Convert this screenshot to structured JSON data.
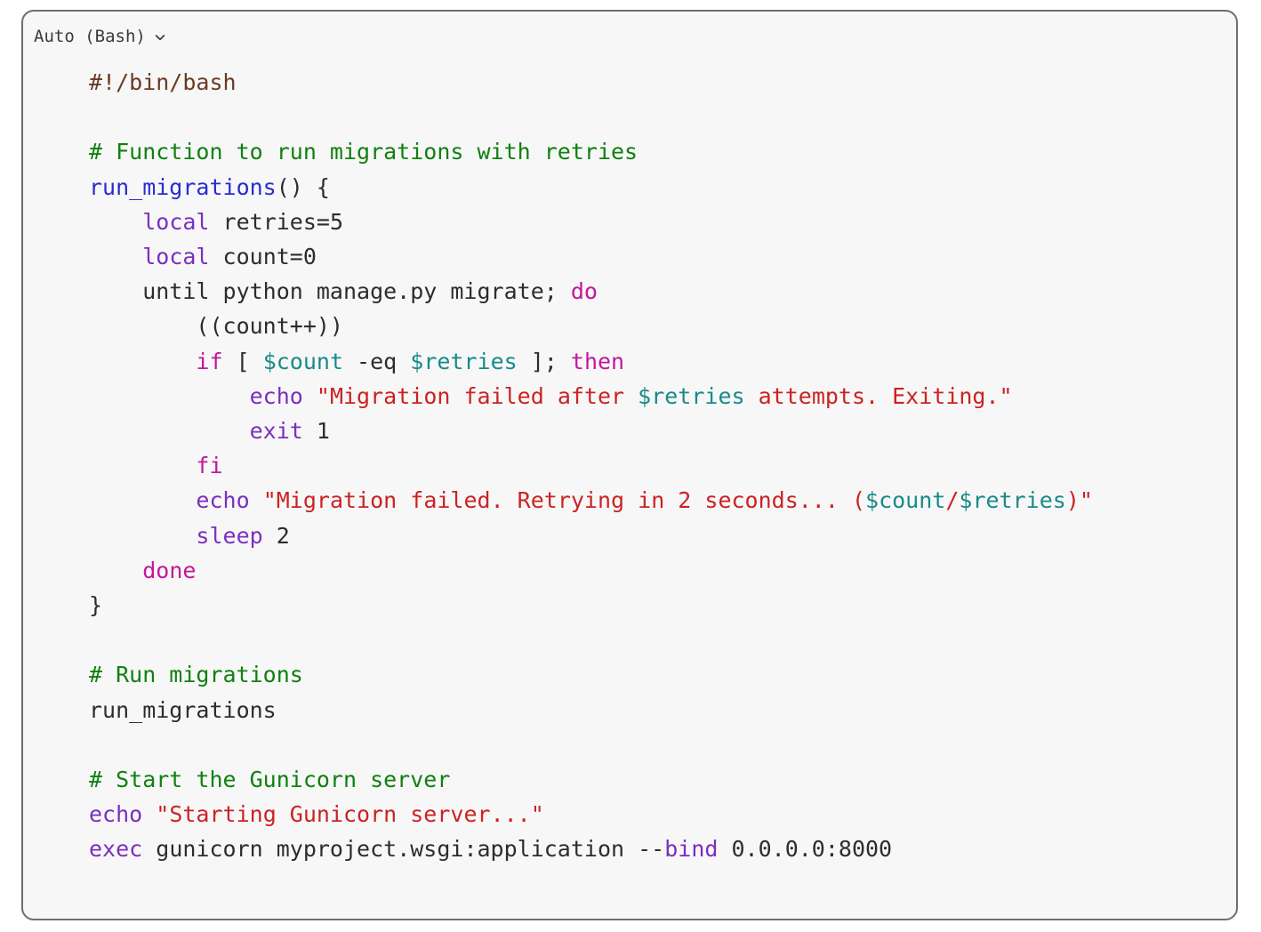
{
  "panel": {
    "language_label": "Auto (Bash)",
    "chevron_icon": "chevron-down-icon"
  },
  "colors": {
    "background": "#f7f7f7",
    "border": "#6e6e6e",
    "text": "#2d2d2d",
    "shebang": "#6a3b22",
    "comment": "#108010",
    "function": "#2b2bd0",
    "builtin": "#7b2fbe",
    "keyword": "#c3189a",
    "string": "#cc2222",
    "variable": "#1a8a8a"
  },
  "code": {
    "language": "bash",
    "lines": [
      [
        {
          "t": "#!/bin/bash",
          "c": "shebang"
        }
      ],
      [],
      [
        {
          "t": "# Function to run migrations with retries",
          "c": "comment"
        }
      ],
      [
        {
          "t": "run_migrations",
          "c": "func"
        },
        {
          "t": "() {",
          "c": "plain"
        }
      ],
      [
        {
          "t": "    ",
          "c": "plain"
        },
        {
          "t": "local",
          "c": "builtin"
        },
        {
          "t": " retries=5",
          "c": "plain"
        }
      ],
      [
        {
          "t": "    ",
          "c": "plain"
        },
        {
          "t": "local",
          "c": "builtin"
        },
        {
          "t": " count=0",
          "c": "plain"
        }
      ],
      [
        {
          "t": "    until python manage.py migrate; ",
          "c": "plain"
        },
        {
          "t": "do",
          "c": "keyword"
        }
      ],
      [
        {
          "t": "        ((count++))",
          "c": "plain"
        }
      ],
      [
        {
          "t": "        ",
          "c": "plain"
        },
        {
          "t": "if",
          "c": "keyword"
        },
        {
          "t": " [ ",
          "c": "plain"
        },
        {
          "t": "$count",
          "c": "var"
        },
        {
          "t": " -eq ",
          "c": "plain"
        },
        {
          "t": "$retries",
          "c": "var"
        },
        {
          "t": " ]; ",
          "c": "plain"
        },
        {
          "t": "then",
          "c": "keyword"
        }
      ],
      [
        {
          "t": "            ",
          "c": "plain"
        },
        {
          "t": "echo",
          "c": "builtin"
        },
        {
          "t": " ",
          "c": "plain"
        },
        {
          "t": "\"Migration failed after ",
          "c": "string"
        },
        {
          "t": "$retries",
          "c": "var"
        },
        {
          "t": " attempts. Exiting.\"",
          "c": "string"
        }
      ],
      [
        {
          "t": "            ",
          "c": "plain"
        },
        {
          "t": "exit",
          "c": "builtin"
        },
        {
          "t": " 1",
          "c": "plain"
        }
      ],
      [
        {
          "t": "        ",
          "c": "plain"
        },
        {
          "t": "fi",
          "c": "keyword"
        }
      ],
      [
        {
          "t": "        ",
          "c": "plain"
        },
        {
          "t": "echo",
          "c": "builtin"
        },
        {
          "t": " ",
          "c": "plain"
        },
        {
          "t": "\"Migration failed. Retrying in 2 seconds... (",
          "c": "string"
        },
        {
          "t": "$count",
          "c": "var"
        },
        {
          "t": "/",
          "c": "string"
        },
        {
          "t": "$retries",
          "c": "var"
        },
        {
          "t": ")\"",
          "c": "string"
        }
      ],
      [
        {
          "t": "        ",
          "c": "plain"
        },
        {
          "t": "sleep",
          "c": "builtin"
        },
        {
          "t": " 2",
          "c": "plain"
        }
      ],
      [
        {
          "t": "    ",
          "c": "plain"
        },
        {
          "t": "done",
          "c": "keyword"
        }
      ],
      [
        {
          "t": "}",
          "c": "plain"
        }
      ],
      [],
      [
        {
          "t": "# Run migrations",
          "c": "comment"
        }
      ],
      [
        {
          "t": "run_migrations",
          "c": "plain"
        }
      ],
      [],
      [
        {
          "t": "# Start the Gunicorn server",
          "c": "comment"
        }
      ],
      [
        {
          "t": "echo",
          "c": "builtin"
        },
        {
          "t": " ",
          "c": "plain"
        },
        {
          "t": "\"Starting Gunicorn server...\"",
          "c": "string"
        }
      ],
      [
        {
          "t": "exec",
          "c": "builtin"
        },
        {
          "t": " gunicorn myproject.wsgi:application --",
          "c": "plain"
        },
        {
          "t": "bind",
          "c": "builtin"
        },
        {
          "t": " 0.0.0.0:8000",
          "c": "plain"
        }
      ]
    ]
  }
}
